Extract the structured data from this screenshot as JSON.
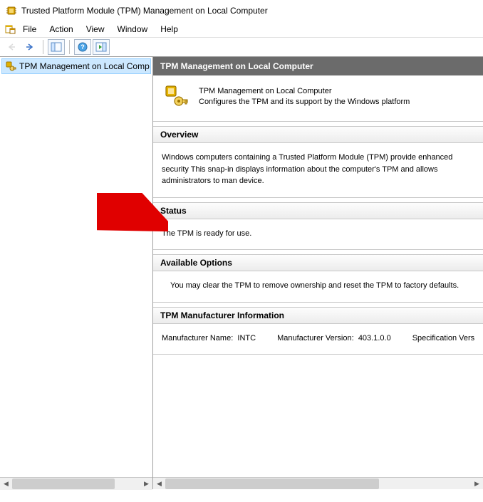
{
  "window": {
    "title": "Trusted Platform Module (TPM) Management on Local Computer"
  },
  "menu": {
    "file": "File",
    "action": "Action",
    "view": "View",
    "window": "Window",
    "help": "Help"
  },
  "tree": {
    "root": "TPM Management on Local Comp"
  },
  "content": {
    "title": "TPM Management on Local Computer",
    "desc_title": "TPM Management on Local Computer",
    "desc_body": "Configures the TPM and its support by the Windows platform",
    "sections": {
      "overview": {
        "header": "Overview",
        "body": "Windows computers containing a Trusted Platform Module (TPM) provide enhanced security This snap-in displays information about the computer's TPM and allows administrators to man device."
      },
      "status": {
        "header": "Status",
        "body": "The TPM is ready for use."
      },
      "options": {
        "header": "Available Options",
        "body": "You may clear the TPM to remove ownership and reset the TPM to factory defaults."
      },
      "manufacturer": {
        "header": "TPM Manufacturer Information",
        "name_label": "Manufacturer Name:",
        "name_value": "INTC",
        "version_label": "Manufacturer Version:",
        "version_value": "403.1.0.0",
        "spec_label": "Specification Vers"
      }
    }
  }
}
